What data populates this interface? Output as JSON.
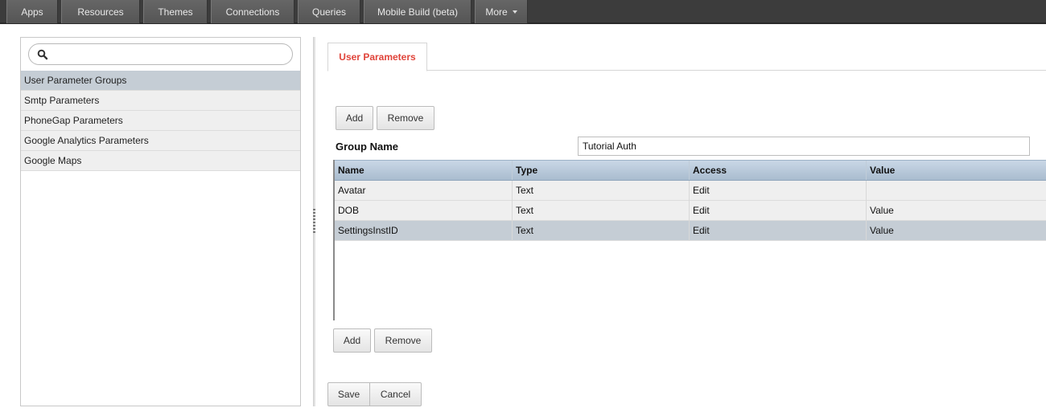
{
  "topnav": {
    "tabs": [
      "Apps",
      "Resources",
      "Themes",
      "Connections",
      "Queries",
      "Mobile Build (beta)",
      "More"
    ]
  },
  "sidebar": {
    "search_placeholder": "",
    "items": [
      {
        "label": "User Parameter Groups",
        "selected": true
      },
      {
        "label": "Smtp Parameters"
      },
      {
        "label": "PhoneGap Parameters"
      },
      {
        "label": "Google Analytics Parameters"
      },
      {
        "label": "Google Maps"
      }
    ]
  },
  "main": {
    "tab_label": "User Parameters",
    "add_label": "Add",
    "remove_label": "Remove",
    "group_name_label": "Group Name",
    "group_name_value": "Tutorial Auth",
    "grid": {
      "columns": [
        "Name",
        "Type",
        "Access",
        "Value"
      ],
      "rows": [
        {
          "name": "Avatar",
          "type": "Text",
          "access": "Edit",
          "value": ""
        },
        {
          "name": "DOB",
          "type": "Text",
          "access": "Edit",
          "value": "Value"
        },
        {
          "name": "SettingsInstID",
          "type": "Text",
          "access": "Edit",
          "value": "Value",
          "selected": true
        }
      ]
    },
    "save_label": "Save",
    "cancel_label": "Cancel"
  }
}
